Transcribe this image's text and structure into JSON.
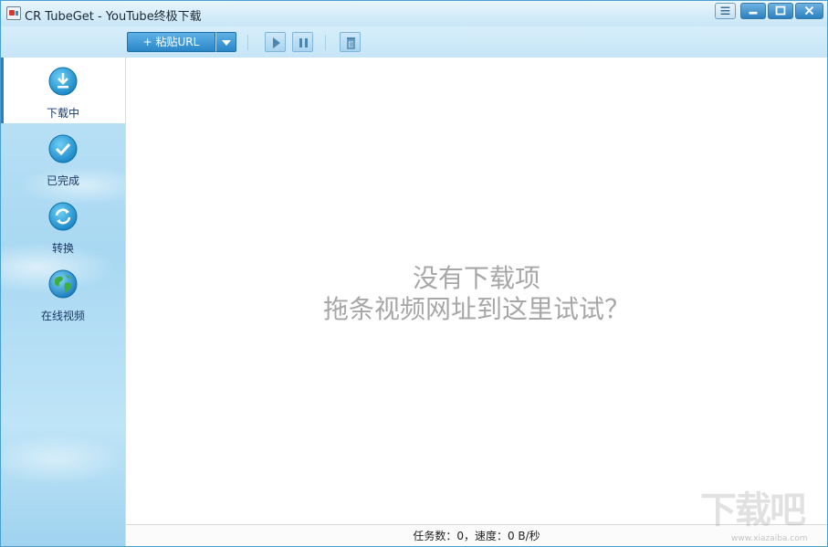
{
  "window": {
    "title": "CR TubeGet - YouTube终极下载"
  },
  "toolbar": {
    "paste_label": "+ 粘贴URL"
  },
  "sidebar": {
    "items": [
      {
        "label": "下载中",
        "icon": "download-icon",
        "active": true
      },
      {
        "label": "已完成",
        "icon": "checkmark-icon",
        "active": false
      },
      {
        "label": "转换",
        "icon": "convert-icon",
        "active": false
      },
      {
        "label": "在线视频",
        "icon": "globe-icon",
        "active": false
      }
    ]
  },
  "main": {
    "empty_line1": "没有下载项",
    "empty_line2": "拖条视频网址到这里试试？"
  },
  "status": {
    "text": "任务数：0，速度：0 B/秒"
  },
  "watermark": {
    "text": "下载吧",
    "url": "www.xiazaiba.com"
  },
  "colors": {
    "accent": "#2a86c9",
    "sidebar_bg": "#a8d8f2",
    "empty_text": "#a7a7a7"
  }
}
